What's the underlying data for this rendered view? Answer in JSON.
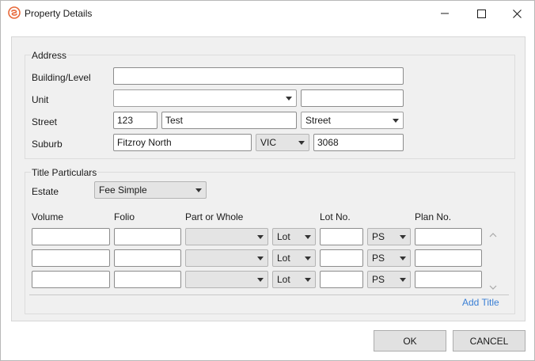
{
  "window": {
    "title": "Property Details",
    "icon": "app-logo-icon",
    "controls": [
      "minimize-icon",
      "maximize-icon",
      "close-icon"
    ],
    "accent_color": "#e8693a"
  },
  "address": {
    "section_title": "Address",
    "labels": {
      "building": "Building/Level",
      "unit": "Unit",
      "street": "Street",
      "suburb": "Suburb"
    },
    "building_value": "",
    "unit_type_value": "",
    "unit_number_value": "",
    "street_number_value": "123",
    "street_name_value": "Test",
    "street_type_value": "Street",
    "suburb_value": "Fitzroy North",
    "state_value": "VIC",
    "postcode_value": "3068"
  },
  "title": {
    "section_title": "Title Particulars",
    "estate_label": "Estate",
    "estate_value": "Fee Simple",
    "columns": [
      "Volume",
      "Folio",
      "Part or Whole",
      "Lot No.",
      "Plan No."
    ],
    "rows": [
      {
        "volume": "",
        "folio": "",
        "part": "",
        "lot_type": "Lot",
        "lot_no": "",
        "plan_type": "PS",
        "plan_no": ""
      },
      {
        "volume": "",
        "folio": "",
        "part": "",
        "lot_type": "Lot",
        "lot_no": "",
        "plan_type": "PS",
        "plan_no": ""
      },
      {
        "volume": "",
        "folio": "",
        "part": "",
        "lot_type": "Lot",
        "lot_no": "",
        "plan_type": "PS",
        "plan_no": ""
      }
    ],
    "add_title_label": "Add Title"
  },
  "buttons": {
    "ok": "OK",
    "cancel": "CANCEL"
  }
}
